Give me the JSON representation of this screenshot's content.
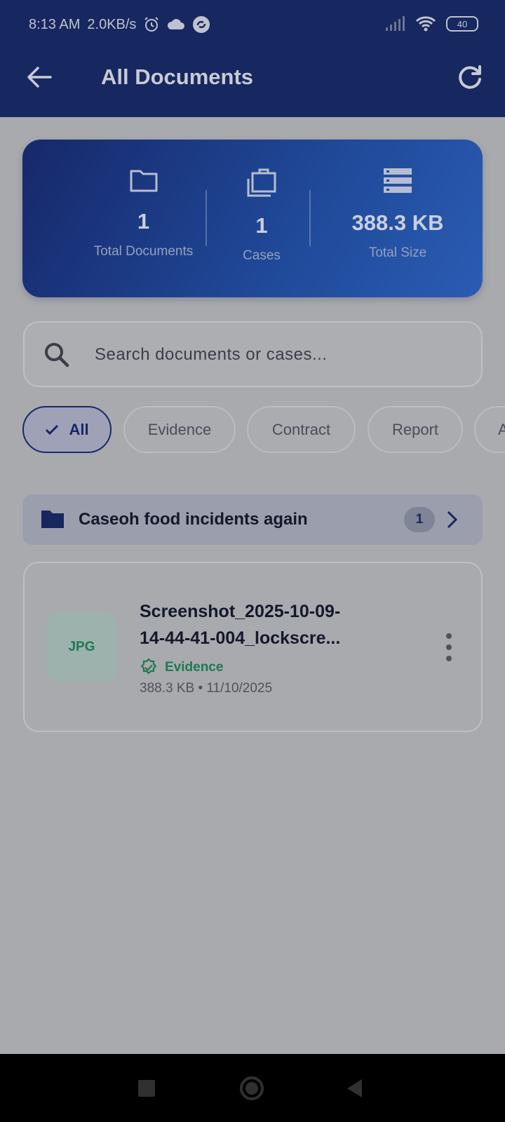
{
  "status_bar": {
    "time": "8:13 AM",
    "speed": "2.0KB/s",
    "battery": "40"
  },
  "app_bar": {
    "title": "All Documents"
  },
  "stats": {
    "total_documents_value": "1",
    "total_documents_label": "Total Documents",
    "cases_value": "1",
    "cases_label": "Cases",
    "total_size_value": "388.3 KB",
    "total_size_label": "Total Size"
  },
  "search": {
    "placeholder": "Search documents or cases..."
  },
  "filters": [
    {
      "label": "All",
      "selected": true
    },
    {
      "label": "Evidence",
      "selected": false
    },
    {
      "label": "Contract",
      "selected": false
    },
    {
      "label": "Report",
      "selected": false
    },
    {
      "label": "A",
      "selected": false
    }
  ],
  "case_group": {
    "name": "Caseoh food incidents again",
    "count": "1"
  },
  "document": {
    "type": "JPG",
    "name_line1": "Screenshot_2025-10-09-",
    "name_line2": "14-44-41-004_lockscre...",
    "tag": "Evidence",
    "meta": "388.3 KB • 11/10/2025"
  },
  "colors": {
    "primary": "#17275f",
    "evidence_green": "#1c7a52"
  }
}
